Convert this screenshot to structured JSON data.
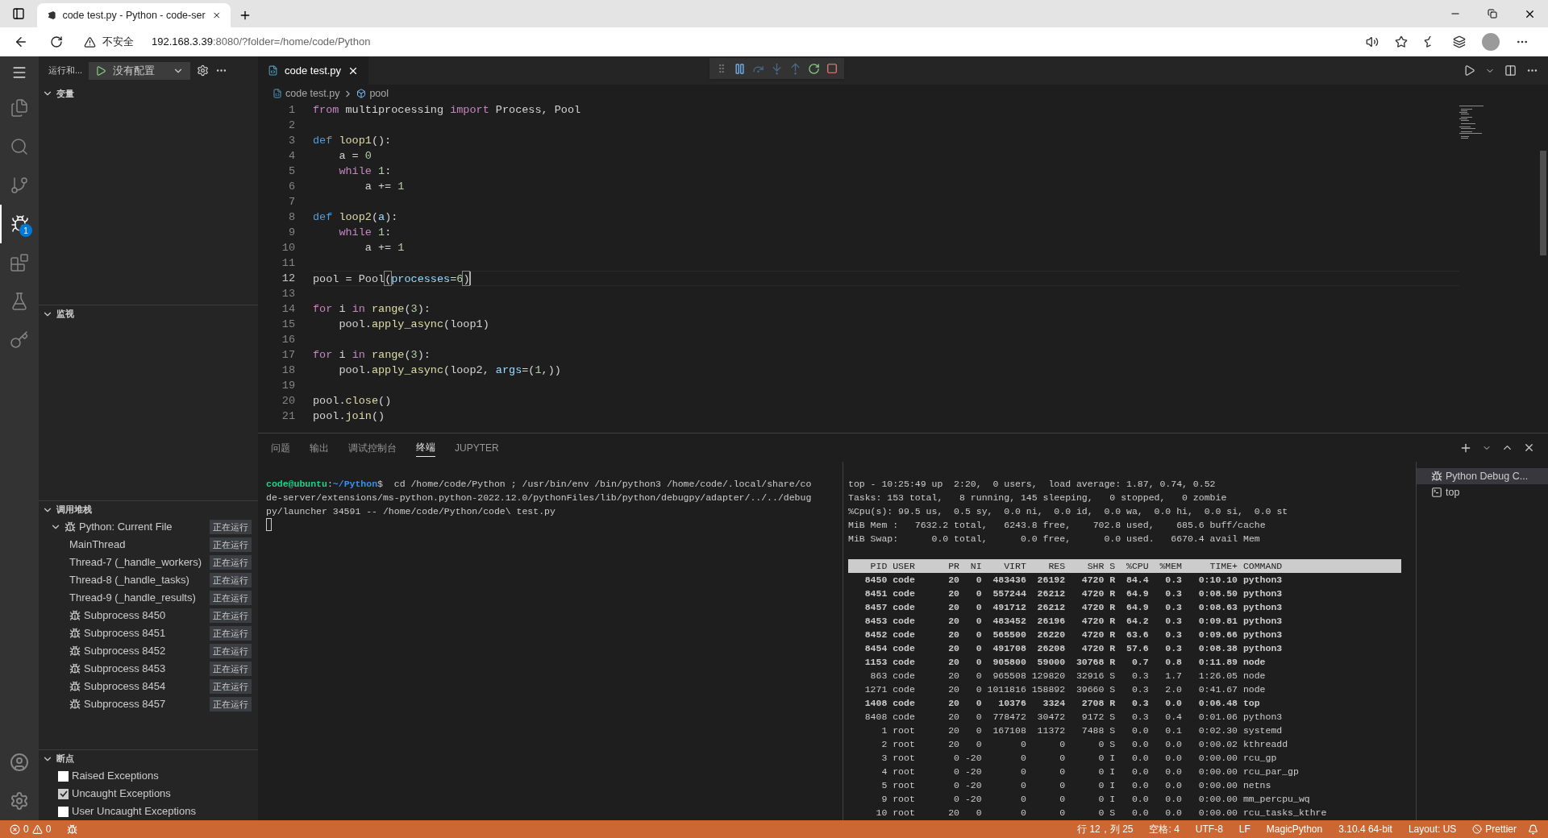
{
  "browser": {
    "tabs": [
      {
        "title": "code test.py - Python - code-ser",
        "selected": true
      }
    ],
    "address": {
      "security": "不安全",
      "host": "192.168.3.39",
      "path": ":8080/?folder=/home/code/Python"
    }
  },
  "activity_bar": {
    "items": [
      {
        "kind": "files",
        "selected": false
      },
      {
        "kind": "search",
        "selected": false
      },
      {
        "kind": "scm",
        "selected": false
      },
      {
        "kind": "debug",
        "selected": true,
        "badge": "1"
      },
      {
        "kind": "extensions",
        "selected": false
      },
      {
        "kind": "testing",
        "selected": false
      },
      {
        "kind": "remote",
        "selected": false
      }
    ]
  },
  "sidebar": {
    "title": "运行和...",
    "config": "没有配置",
    "variables": {
      "title": "变量",
      "expanded": true
    },
    "watch": {
      "title": "监视",
      "expanded": true
    },
    "call_stack": {
      "title": "调用堆栈",
      "expanded": true,
      "items": [
        {
          "label": "Python: Current File",
          "kind": "session",
          "expanded": true,
          "status": "正在运行",
          "children": [
            {
              "label": "MainThread",
              "kind": "thread",
              "status": "正在运行"
            },
            {
              "label": "Thread-7 (_handle_workers)",
              "kind": "thread",
              "status": "正在运行"
            },
            {
              "label": "Thread-8 (_handle_tasks)",
              "kind": "thread",
              "status": "正在运行"
            },
            {
              "label": "Thread-9 (_handle_results)",
              "kind": "thread",
              "status": "正在运行"
            },
            {
              "label": "Subprocess 8450",
              "kind": "process",
              "status": "正在运行"
            },
            {
              "label": "Subprocess 8451",
              "kind": "process",
              "status": "正在运行"
            },
            {
              "label": "Subprocess 8452",
              "kind": "process",
              "status": "正在运行"
            },
            {
              "label": "Subprocess 8453",
              "kind": "process",
              "status": "正在运行"
            },
            {
              "label": "Subprocess 8454",
              "kind": "process",
              "status": "正在运行"
            },
            {
              "label": "Subprocess 8457",
              "kind": "process",
              "status": "正在运行"
            }
          ]
        }
      ]
    },
    "breakpoints": {
      "title": "断点",
      "expanded": true,
      "items": [
        {
          "label": "Raised Exceptions",
          "checked": false
        },
        {
          "label": "Uncaught Exceptions",
          "checked": true
        },
        {
          "label": "User Uncaught Exceptions",
          "checked": false
        }
      ]
    }
  },
  "editor": {
    "tabs": [
      {
        "title": "code test.py",
        "selected": true
      }
    ],
    "breadcrumbs": [
      {
        "text": "code test.py",
        "kind": "file"
      },
      {
        "text": "pool",
        "kind": "symbol"
      }
    ],
    "lines": [
      {
        "number": "1",
        "current": false,
        "tokens": [
          {
            "text": "from",
            "kind": "control"
          },
          {
            "text": " multiprocessing ",
            "kind": "plain"
          },
          {
            "text": "import",
            "kind": "control"
          },
          {
            "text": " Process, Pool",
            "kind": "plain"
          }
        ]
      },
      {
        "number": "2",
        "current": false
      },
      {
        "number": "3",
        "current": false,
        "tokens": [
          {
            "text": "def ",
            "kind": "keyword"
          },
          {
            "text": "loop1",
            "kind": "function"
          },
          {
            "text": "():",
            "kind": "plain"
          }
        ]
      },
      {
        "number": "4",
        "current": false,
        "tokens": [
          {
            "text": "    a = ",
            "kind": "plain"
          },
          {
            "text": "0",
            "kind": "number"
          }
        ]
      },
      {
        "number": "5",
        "current": false,
        "tokens": [
          {
            "text": "    while ",
            "kind": "control"
          },
          {
            "text": "1",
            "kind": "number"
          },
          {
            "text": ":",
            "kind": "plain"
          }
        ]
      },
      {
        "number": "6",
        "current": false,
        "tokens": [
          {
            "text": "        a += ",
            "kind": "plain"
          },
          {
            "text": "1",
            "kind": "number"
          }
        ]
      },
      {
        "number": "7",
        "current": false
      },
      {
        "number": "8",
        "current": false,
        "tokens": [
          {
            "text": "def ",
            "kind": "keyword"
          },
          {
            "text": "loop2",
            "kind": "function"
          },
          {
            "text": "(",
            "kind": "plain"
          },
          {
            "text": "a",
            "kind": "param"
          },
          {
            "text": "):",
            "kind": "plain"
          }
        ]
      },
      {
        "number": "9",
        "current": false,
        "tokens": [
          {
            "text": "    while ",
            "kind": "control"
          },
          {
            "text": "1",
            "kind": "number"
          },
          {
            "text": ":",
            "kind": "plain"
          }
        ]
      },
      {
        "number": "10",
        "current": false,
        "tokens": [
          {
            "text": "        a += ",
            "kind": "plain"
          },
          {
            "text": "1",
            "kind": "number"
          }
        ]
      },
      {
        "number": "11",
        "current": false
      },
      {
        "number": "12",
        "current": true,
        "tokens": [
          {
            "text": "pool = ",
            "kind": "plain"
          },
          {
            "text": "Pool",
            "kind": "plain"
          },
          {
            "text": "(",
            "kind": "bracket"
          },
          {
            "text": "processes",
            "kind": "param"
          },
          {
            "text": "=",
            "kind": "plain"
          },
          {
            "text": "6",
            "kind": "number"
          },
          {
            "text": ")",
            "kind": "bracket"
          }
        ]
      },
      {
        "number": "13",
        "current": false
      },
      {
        "number": "14",
        "current": false,
        "tokens": [
          {
            "text": "for",
            "kind": "control"
          },
          {
            "text": " i ",
            "kind": "plain"
          },
          {
            "text": "in ",
            "kind": "control"
          },
          {
            "text": "range",
            "kind": "function"
          },
          {
            "text": "(",
            "kind": "plain"
          },
          {
            "text": "3",
            "kind": "number"
          },
          {
            "text": "):",
            "kind": "plain"
          }
        ]
      },
      {
        "number": "15",
        "current": false,
        "tokens": [
          {
            "text": "    pool.",
            "kind": "plain"
          },
          {
            "text": "apply_async",
            "kind": "function"
          },
          {
            "text": "(loop1)",
            "kind": "plain"
          }
        ]
      },
      {
        "number": "16",
        "current": false
      },
      {
        "number": "17",
        "current": false,
        "tokens": [
          {
            "text": "for",
            "kind": "control"
          },
          {
            "text": " i ",
            "kind": "plain"
          },
          {
            "text": "in ",
            "kind": "control"
          },
          {
            "text": "range",
            "kind": "function"
          },
          {
            "text": "(",
            "kind": "plain"
          },
          {
            "text": "3",
            "kind": "number"
          },
          {
            "text": "):",
            "kind": "plain"
          }
        ]
      },
      {
        "number": "18",
        "current": false,
        "tokens": [
          {
            "text": "    pool.",
            "kind": "plain"
          },
          {
            "text": "apply_async",
            "kind": "function"
          },
          {
            "text": "(loop2, ",
            "kind": "plain"
          },
          {
            "text": "args",
            "kind": "param"
          },
          {
            "text": "=(",
            "kind": "plain"
          },
          {
            "text": "1",
            "kind": "number"
          },
          {
            "text": ",))",
            "kind": "plain"
          }
        ]
      },
      {
        "number": "19",
        "current": false
      },
      {
        "number": "20",
        "current": false,
        "tokens": [
          {
            "text": "pool.",
            "kind": "plain"
          },
          {
            "text": "close",
            "kind": "function"
          },
          {
            "text": "()",
            "kind": "plain"
          }
        ]
      },
      {
        "number": "21",
        "current": false,
        "tokens": [
          {
            "text": "pool.",
            "kind": "plain"
          },
          {
            "text": "join",
            "kind": "function"
          },
          {
            "text": "()",
            "kind": "plain"
          }
        ]
      }
    ]
  },
  "panel": {
    "tabs": [
      {
        "label": "问题",
        "selected": false
      },
      {
        "label": "输出",
        "selected": false
      },
      {
        "label": "调试控制台",
        "selected": false
      },
      {
        "label": "终端",
        "selected": true
      },
      {
        "label": "JUPYTER",
        "selected": false
      }
    ],
    "terminal_left": {
      "segments": [
        {
          "text": "code@ubuntu",
          "kind": "user"
        },
        {
          "text": ":",
          "kind": "plain"
        },
        {
          "text": "~/Python",
          "kind": "path"
        },
        {
          "text": "$  cd /home/code/Python ; /usr/bin/env /bin/python3 /home/code/.local/share/co",
          "kind": "plain"
        }
      ],
      "lines": [
        "de-server/extensions/ms-python.python-2022.12.0/pythonFiles/lib/python/debugpy/adapter/../../debug",
        "py/launcher 34591 -- /home/code/Python/code\\ test.py"
      ]
    },
    "terminal_right": {
      "summary": [
        "top - 10:25:49 up  2:20,  0 users,  load average: 1.87, 0.74, 0.52",
        "Tasks: 153 total,   8 running, 145 sleeping,   0 stopped,   0 zombie",
        "%Cpu(s): 99.5 us,  0.5 sy,  0.0 ni,  0.0 id,  0.0 wa,  0.0 hi,  0.0 si,  0.0 st",
        "MiB Mem :   7632.2 total,   6243.8 free,    702.8 used,    685.6 buff/cache",
        "MiB Swap:      0.0 total,      0.0 free,      0.0 used.   6670.4 avail Mem"
      ],
      "columns": [
        "PID",
        "USER",
        "PR",
        "NI",
        "VIRT",
        "RES",
        "SHR",
        "S",
        "%CPU",
        "%MEM",
        "TIME+",
        "COMMAND"
      ],
      "rows": [
        {
          "bold": true,
          "cells": [
            "8450",
            "code",
            "20",
            "0",
            "483436",
            "26192",
            "4720",
            "R",
            "84.4",
            "0.3",
            "0:10.10",
            "python3"
          ]
        },
        {
          "bold": true,
          "cells": [
            "8451",
            "code",
            "20",
            "0",
            "557244",
            "26212",
            "4720",
            "R",
            "64.9",
            "0.3",
            "0:08.50",
            "python3"
          ]
        },
        {
          "bold": true,
          "cells": [
            "8457",
            "code",
            "20",
            "0",
            "491712",
            "26212",
            "4720",
            "R",
            "64.9",
            "0.3",
            "0:08.63",
            "python3"
          ]
        },
        {
          "bold": true,
          "cells": [
            "8453",
            "code",
            "20",
            "0",
            "483452",
            "26196",
            "4720",
            "R",
            "64.2",
            "0.3",
            "0:09.81",
            "python3"
          ]
        },
        {
          "bold": true,
          "cells": [
            "8452",
            "code",
            "20",
            "0",
            "565500",
            "26220",
            "4720",
            "R",
            "63.6",
            "0.3",
            "0:09.66",
            "python3"
          ]
        },
        {
          "bold": true,
          "cells": [
            "8454",
            "code",
            "20",
            "0",
            "491708",
            "26208",
            "4720",
            "R",
            "57.6",
            "0.3",
            "0:08.38",
            "python3"
          ]
        },
        {
          "bold": true,
          "cells": [
            "1153",
            "code",
            "20",
            "0",
            "905800",
            "59000",
            "30768",
            "R",
            "0.7",
            "0.8",
            "0:11.89",
            "node"
          ]
        },
        {
          "bold": false,
          "cells": [
            "863",
            "code",
            "20",
            "0",
            "965508",
            "129820",
            "32916",
            "S",
            "0.3",
            "1.7",
            "1:26.05",
            "node"
          ]
        },
        {
          "bold": false,
          "cells": [
            "1271",
            "code",
            "20",
            "0",
            "1011816",
            "158892",
            "39660",
            "S",
            "0.3",
            "2.0",
            "0:41.67",
            "node"
          ]
        },
        {
          "bold": true,
          "cells": [
            "1408",
            "code",
            "20",
            "0",
            "10376",
            "3324",
            "2708",
            "R",
            "0.3",
            "0.0",
            "0:06.48",
            "top"
          ]
        },
        {
          "bold": false,
          "cells": [
            "8408",
            "code",
            "20",
            "0",
            "778472",
            "30472",
            "9172",
            "S",
            "0.3",
            "0.4",
            "0:01.06",
            "python3"
          ]
        },
        {
          "bold": false,
          "cells": [
            "1",
            "root",
            "20",
            "0",
            "167108",
            "11372",
            "7488",
            "S",
            "0.0",
            "0.1",
            "0:02.30",
            "systemd"
          ]
        },
        {
          "bold": false,
          "cells": [
            "2",
            "root",
            "20",
            "0",
            "0",
            "0",
            "0",
            "S",
            "0.0",
            "0.0",
            "0:00.02",
            "kthreadd"
          ]
        },
        {
          "bold": false,
          "cells": [
            "3",
            "root",
            "0",
            "-20",
            "0",
            "0",
            "0",
            "I",
            "0.0",
            "0.0",
            "0:00.00",
            "rcu_gp"
          ]
        },
        {
          "bold": false,
          "cells": [
            "4",
            "root",
            "0",
            "-20",
            "0",
            "0",
            "0",
            "I",
            "0.0",
            "0.0",
            "0:00.00",
            "rcu_par_gp"
          ]
        },
        {
          "bold": false,
          "cells": [
            "5",
            "root",
            "0",
            "-20",
            "0",
            "0",
            "0",
            "I",
            "0.0",
            "0.0",
            "0:00.00",
            "netns"
          ]
        },
        {
          "bold": false,
          "cells": [
            "9",
            "root",
            "0",
            "-20",
            "0",
            "0",
            "0",
            "I",
            "0.0",
            "0.0",
            "0:00.00",
            "mm_percpu_wq"
          ]
        },
        {
          "bold": false,
          "cells": [
            "10",
            "root",
            "20",
            "0",
            "0",
            "0",
            "0",
            "S",
            "0.0",
            "0.0",
            "0:00.00",
            "rcu_tasks_kthre"
          ]
        }
      ]
    },
    "terminals": [
      {
        "label": "Python Debug C...",
        "kind": "debug",
        "selected": true
      },
      {
        "label": "top",
        "kind": "shell",
        "selected": false
      }
    ]
  },
  "status_bar": {
    "errors": "0",
    "warnings": "0",
    "right": [
      "行 12，列 25",
      "空格: 4",
      "UTF-8",
      "LF",
      "MagicPython",
      "3.10.4 64-bit",
      "Layout: US"
    ],
    "formatter": "Prettier"
  }
}
